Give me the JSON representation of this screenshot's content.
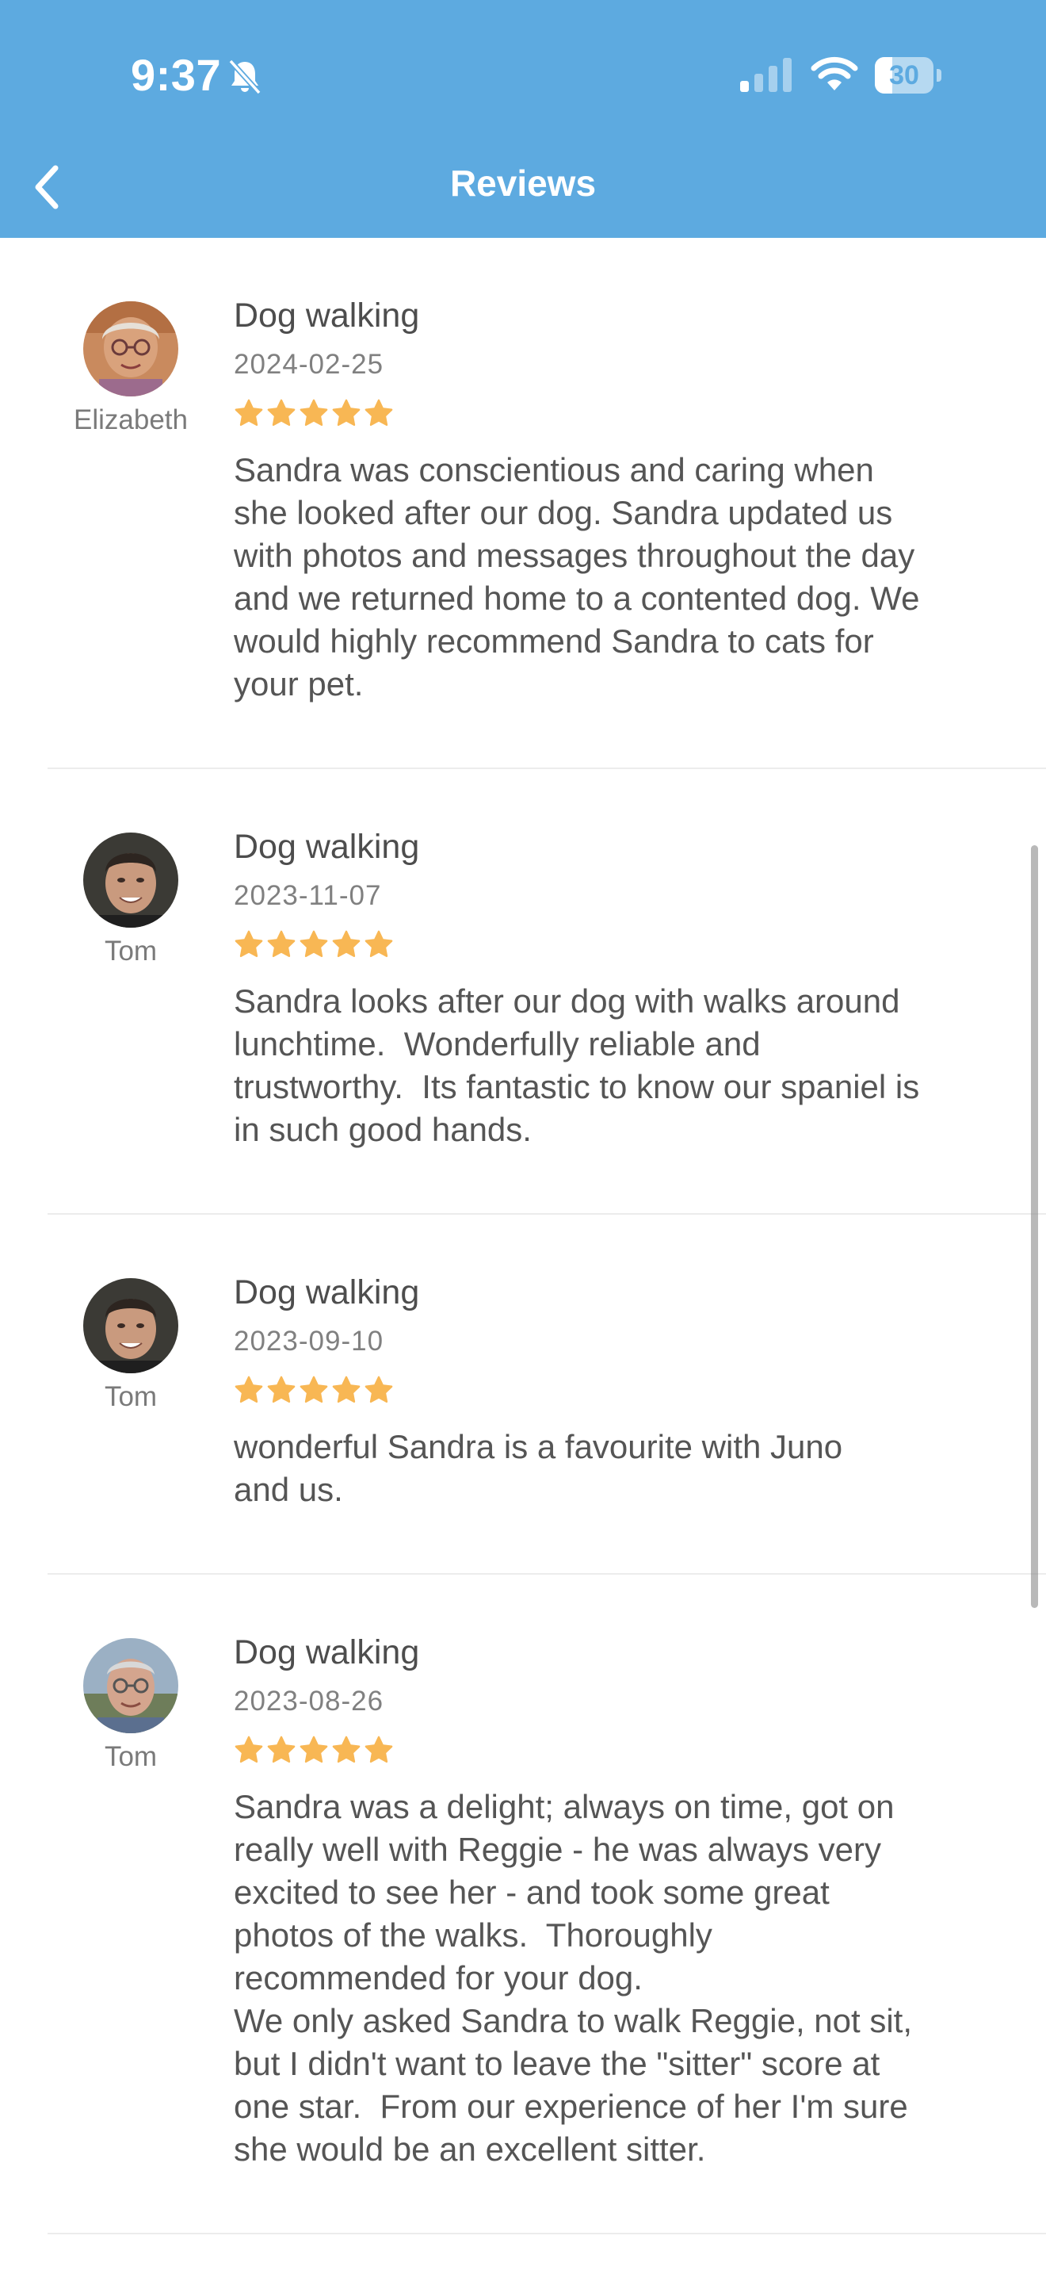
{
  "status_bar": {
    "time": "9:37",
    "battery": "30",
    "battery_fraction": 0.3
  },
  "nav": {
    "title": "Reviews",
    "back_icon": "chevron-left-icon"
  },
  "colors": {
    "header": "#5DAAE0",
    "star": "#F8B754",
    "text": "#555555",
    "muted": "#808080"
  },
  "reviews": [
    {
      "reviewer": "Elizabeth",
      "service": "Dog walking",
      "date": "2024-02-25",
      "rating": 5,
      "text": "Sandra was conscientious and caring when\nshe looked after our dog. Sandra updated us\nwith photos and messages throughout the day\nand we returned home to a contented dog. We\nwould highly recommend Sandra to cats for\nyour pet."
    },
    {
      "reviewer": "Tom",
      "service": "Dog walking",
      "date": "2023-11-07",
      "rating": 5,
      "text": "Sandra looks after our dog with walks around\nlunchtime.  Wonderfully reliable and\ntrustworthy.  Its fantastic to know our spaniel is\nin such good hands."
    },
    {
      "reviewer": "Tom",
      "service": "Dog walking",
      "date": "2023-09-10",
      "rating": 5,
      "text": "wonderful Sandra is a favourite with Juno\nand us."
    },
    {
      "reviewer": "Tom",
      "service": "Dog walking",
      "date": "2023-08-26",
      "rating": 5,
      "text": "Sandra was a delight; always on time, got on\nreally well with Reggie - he was always very\nexcited to see her - and took some great\nphotos of the walks.  Thoroughly\nrecommended for your dog.\nWe only asked Sandra to walk Reggie, not sit,\nbut I didn't want to leave the \"sitter\" score at\none star.  From our experience of her I'm sure\nshe would be an excellent sitter."
    }
  ]
}
